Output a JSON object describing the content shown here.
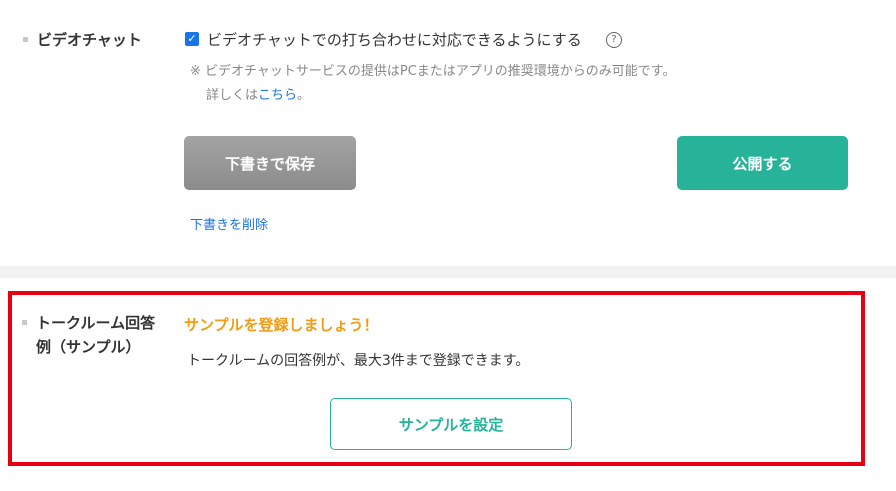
{
  "video_chat": {
    "label": "ビデオチャット",
    "checkbox_checked": true,
    "checkbox_label": "ビデオチャットでの打ち合わせに対応できるようにする",
    "help_icon": "?",
    "note_line1": "※ ビデオチャットサービスの提供はPCまたはアプリの推奨環境からのみ可能です。",
    "note_line2_prefix": "詳しくは",
    "note_link": "こちら",
    "note_line2_suffix": "。"
  },
  "actions": {
    "draft_label": "下書きで保存",
    "publish_label": "公開する",
    "delete_draft_label": "下書きを削除"
  },
  "talkroom": {
    "label_line1": "トークルーム回答",
    "label_line2": "例（サンプル）",
    "cta": "サンプルを登録しましょう！",
    "description": "トークルームの回答例が、最大3件まで登録できます。",
    "button_label": "サンプルを設定"
  },
  "colors": {
    "publish_green": "#27b39a",
    "cta_orange": "#f39c12",
    "highlight_red": "#e60012",
    "link_blue": "#1a73e8"
  }
}
